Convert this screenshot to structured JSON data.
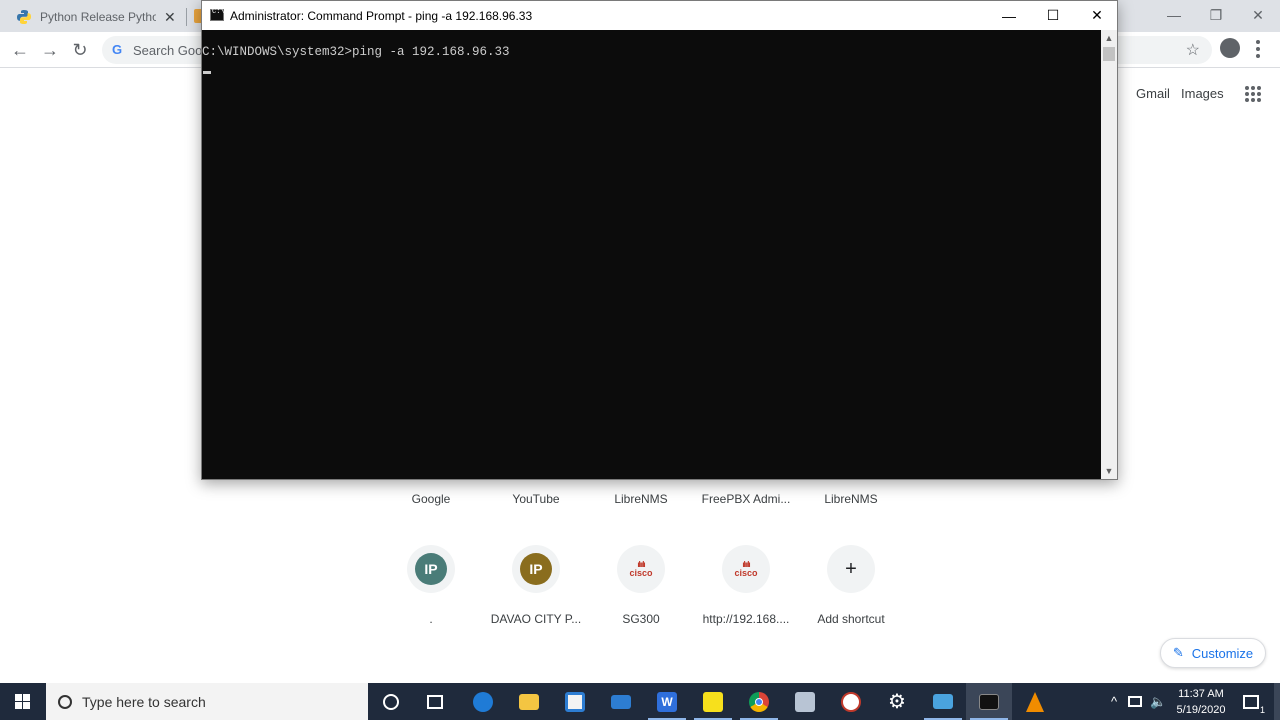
{
  "chrome": {
    "tab_title": "Python Release Python",
    "tab_close": "✕",
    "search_placeholder": "Search Goo",
    "minimize": "—",
    "restore": "❐",
    "close": "✕",
    "gmail": "Gmail",
    "images": "Images",
    "customize": "Customize",
    "nav": {
      "back": "←",
      "forward": "→",
      "reload": "↻",
      "star": "☆"
    }
  },
  "shortcuts_row1": [
    "Google",
    "YouTube",
    "LibreNMS",
    "FreePBX Admi...",
    "LibreNMS"
  ],
  "shortcuts_row2": [
    {
      "label": ".",
      "icon_text": "IP",
      "icon_color": "#4a7c78"
    },
    {
      "label": "DAVAO CITY P...",
      "icon_text": "IP",
      "icon_color": "#8a6d1e"
    },
    {
      "label": "SG300",
      "icon_text": "cisco"
    },
    {
      "label": "http://192.168....",
      "icon_text": "cisco"
    },
    {
      "label": "Add shortcut",
      "icon_text": "+"
    }
  ],
  "cmd": {
    "title": "Administrator: Command Prompt - ping  -a 192.168.96.33",
    "minimize": "—",
    "maximize": "☐",
    "close": "✕",
    "prompt_line": "C:\\WINDOWS\\system32>ping -a 192.168.96.33",
    "scroll_up": "▲",
    "scroll_down": "▼"
  },
  "taskbar": {
    "search_placeholder": "Type here to search",
    "time": "11:37 AM",
    "date": "5/19/2020",
    "notification_count": "1",
    "tray_chevron": "^"
  }
}
